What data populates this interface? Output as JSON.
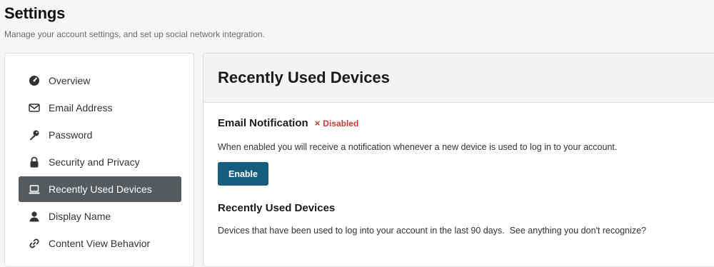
{
  "header": {
    "title": "Settings",
    "subtitle": "Manage your account settings, and set up social network integration."
  },
  "sidebar": {
    "items": [
      {
        "label": "Overview",
        "icon": "gauge-icon",
        "active": false
      },
      {
        "label": "Email Address",
        "icon": "envelope-icon",
        "active": false
      },
      {
        "label": "Password",
        "icon": "key-icon",
        "active": false
      },
      {
        "label": "Security and Privacy",
        "icon": "lock-icon",
        "active": false
      },
      {
        "label": "Recently Used Devices",
        "icon": "laptop-icon",
        "active": true
      },
      {
        "label": "Display Name",
        "icon": "user-icon",
        "active": false
      },
      {
        "label": "Content View Behavior",
        "icon": "link-icon",
        "active": false
      }
    ]
  },
  "main": {
    "title": "Recently Used Devices",
    "notification": {
      "heading": "Email Notification",
      "status": "Disabled",
      "status_icon": "×",
      "description": "When enabled you will receive a notification whenever a new device is used to log in to your account.",
      "button_label": "Enable"
    },
    "devices": {
      "heading": "Recently Used Devices",
      "description": "Devices that have been used to log into your account in the last 90 days.  See anything you don't recognize?"
    }
  },
  "colors": {
    "active_nav_bg": "#555a5e",
    "button_bg": "#145d7f",
    "status_disabled": "#c63c34"
  }
}
